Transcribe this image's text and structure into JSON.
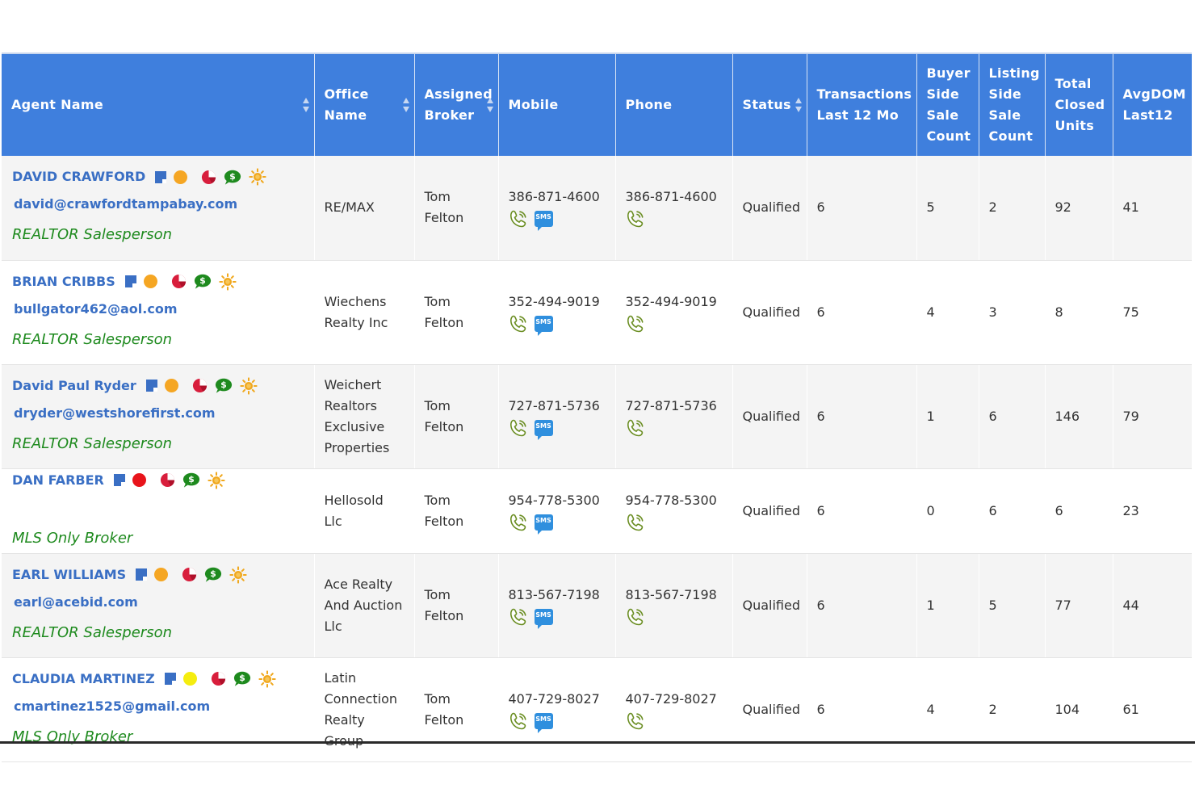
{
  "colors": {
    "header_bg": "#3f7fdd",
    "link_blue": "#3a6fc4",
    "role_green": "#1e8a1e",
    "status_orange": "#f5a623",
    "status_red": "#e8141b",
    "status_yellow": "#f5ed0f",
    "pie_red": "#d81e3c",
    "dollar_green": "#1e8a1e",
    "sun_orange": "#f0a81e",
    "sms_blue": "#2f8fde"
  },
  "headers": {
    "agent_name": "Agent Name",
    "office_name": "Office Name",
    "assigned_broker": "Assigned Broker",
    "mobile": "Mobile",
    "phone": "Phone",
    "status": "Status",
    "transactions": "Transactions Last 12 Mo",
    "buyer_side": "Buyer Side Sale Count",
    "listing_side": "Listing Side Sale Count",
    "total_closed": "Total Closed Units",
    "avg_dom": "AvgDOM Last12"
  },
  "icons": {
    "note": "note-icon",
    "status_dot": "status-dot-icon",
    "pie": "pie-chart-icon",
    "dollar": "dollar-bubble-icon",
    "sun": "sun-icon",
    "call": "phone-call-icon",
    "sms": "sms-icon",
    "sms_text": "SMS"
  },
  "rows": [
    {
      "name": "DAVID CRAWFORD",
      "email": "david@crawfordtampabay.com",
      "role": "REALTOR Salesperson",
      "dot_color": "#f5a623",
      "office": "RE/MAX",
      "broker": "Tom Felton",
      "mobile": "386-871-4600",
      "phone": "386-871-4600",
      "status": "Qualified",
      "transactions": "6",
      "buyer": "5",
      "listing": "2",
      "total": "92",
      "avgdom": "41"
    },
    {
      "name": "BRIAN CRIBBS",
      "email": "bullgator462@aol.com",
      "role": "REALTOR Salesperson",
      "dot_color": "#f5a623",
      "office": "Wiechens Realty Inc",
      "broker": "Tom Felton",
      "mobile": "352-494-9019",
      "phone": "352-494-9019",
      "status": "Qualified",
      "transactions": "6",
      "buyer": "4",
      "listing": "3",
      "total": "8",
      "avgdom": "75"
    },
    {
      "name": "David Paul Ryder",
      "email": "dryder@westshorefirst.com",
      "role": "REALTOR Salesperson",
      "dot_color": "#f5a623",
      "office": "Weichert Realtors Exclusive Properties",
      "broker": "Tom Felton",
      "mobile": "727-871-5736",
      "phone": "727-871-5736",
      "status": "Qualified",
      "transactions": "6",
      "buyer": "1",
      "listing": "6",
      "total": "146",
      "avgdom": "79"
    },
    {
      "name": "DAN FARBER",
      "email": "",
      "role": "MLS Only Broker",
      "dot_color": "#e8141b",
      "office": "Hellosold Llc",
      "broker": "Tom Felton",
      "mobile": "954-778-5300",
      "phone": "954-778-5300",
      "status": "Qualified",
      "transactions": "6",
      "buyer": "0",
      "listing": "6",
      "total": "6",
      "avgdom": "23"
    },
    {
      "name": "EARL WILLIAMS",
      "email": "earl@acebid.com",
      "role": "REALTOR Salesperson",
      "dot_color": "#f5a623",
      "office": "Ace Realty And Auction Llc",
      "broker": "Tom Felton",
      "mobile": "813-567-7198",
      "phone": "813-567-7198",
      "status": "Qualified",
      "transactions": "6",
      "buyer": "1",
      "listing": "5",
      "total": "77",
      "avgdom": "44"
    },
    {
      "name": "CLAUDIA MARTINEZ",
      "email": "cmartinez1525@gmail.com",
      "role": "MLS Only Broker",
      "dot_color": "#f5ed0f",
      "office": "Latin Connection Realty Group",
      "broker": "Tom Felton",
      "mobile": "407-729-8027",
      "phone": "407-729-8027",
      "status": "Qualified",
      "transactions": "6",
      "buyer": "4",
      "listing": "2",
      "total": "104",
      "avgdom": "61"
    }
  ]
}
